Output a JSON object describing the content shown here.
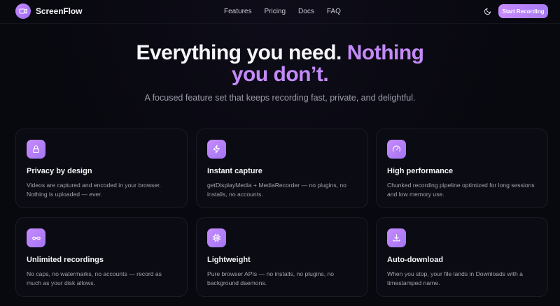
{
  "nav": {
    "brand": "ScreenFlow",
    "links": [
      "Features",
      "Pricing",
      "Docs",
      "FAQ"
    ],
    "cta": "Start Recording"
  },
  "hero": {
    "title_white": "Everything you need.",
    "title_accent_1": "Nothing",
    "title_accent_2": "you don’t.",
    "subtitle": "A focused feature set that keeps recording fast, private, and delightful."
  },
  "features": [
    {
      "icon": "lock-icon",
      "title": "Privacy by design",
      "desc": "Videos are captured and encoded in your browser. Nothing is uploaded — ever."
    },
    {
      "icon": "lightning-icon",
      "title": "Instant capture",
      "desc": "getDisplayMedia + MediaRecorder — no plugins, no installs, no accounts."
    },
    {
      "icon": "gauge-icon",
      "title": "High performance",
      "desc": "Chunked recording pipeline optimized for long sessions and low memory use."
    },
    {
      "icon": "infinity-icon",
      "title": "Unlimited recordings",
      "desc": "No caps, no watermarks, no accounts — record as much as your disk allows."
    },
    {
      "icon": "chip-icon",
      "title": "Lightweight",
      "desc": "Pure browser APIs — no installs, no plugins, no background daemons."
    },
    {
      "icon": "download-icon",
      "title": "Auto-download",
      "desc": "When you stop, your file lands in Downloads with a timestamped name."
    }
  ],
  "colors": {
    "background": "#08080f",
    "accent": "#c48af9",
    "accent_gradient_end": "#a274f2"
  }
}
